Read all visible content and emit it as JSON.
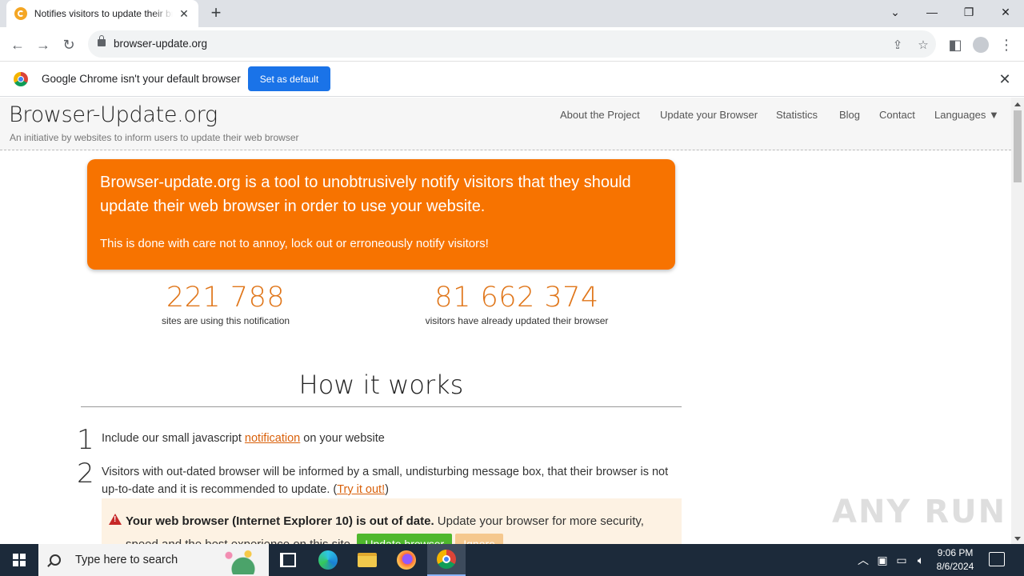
{
  "browser": {
    "tab_title": "Notifies visitors to update their browser",
    "url": "browser-update.org",
    "infobar_message": "Google Chrome isn't your default browser",
    "infobar_button": "Set as default"
  },
  "site": {
    "title": "Browser-Update.org",
    "subtitle": "An initiative by websites to inform users to update their web browser",
    "nav": [
      "About the Project",
      "Update your Browser",
      "Statistics",
      "Blog",
      "Contact",
      "Languages ▼"
    ]
  },
  "hero": {
    "headline": "Browser-update.org is a tool to unobtrusively notify visitors that they should update their web browser in order to use your website.",
    "subline": "This is done with care not to annoy, lock out or erroneously notify visitors!"
  },
  "stats": [
    {
      "value": "221 788",
      "label": "sites are using this notification"
    },
    {
      "value": "81 662 374",
      "label": "visitors have already updated their browser"
    }
  ],
  "how": {
    "heading": "How it works",
    "steps": [
      {
        "num": "1",
        "before": "Include our small javascript ",
        "link": "notification",
        "after": " on your website"
      },
      {
        "num": "2",
        "before": "Visitors with out-dated browser will be informed by a small, undisturbing message box, that their browser is not up-to-date and it is recommended to update. (",
        "link": "Try it out!",
        "after": ")"
      }
    ],
    "demo": {
      "bold": "Your web browser (Internet Explorer 10) is out of date.",
      "text": " Update your browser for more security, speed and the best experience on this site.",
      "update_button": "Update browser",
      "ignore_button": "Ignore"
    }
  },
  "watermark": "ANY RUN",
  "taskbar": {
    "search_placeholder": "Type here to search",
    "time": "9:06 PM",
    "date": "8/6/2024"
  },
  "colors": {
    "accent_orange": "#f77300",
    "stat_orange": "#e0761a",
    "chrome_blue": "#1a73e8",
    "update_green": "#4fb82d"
  }
}
